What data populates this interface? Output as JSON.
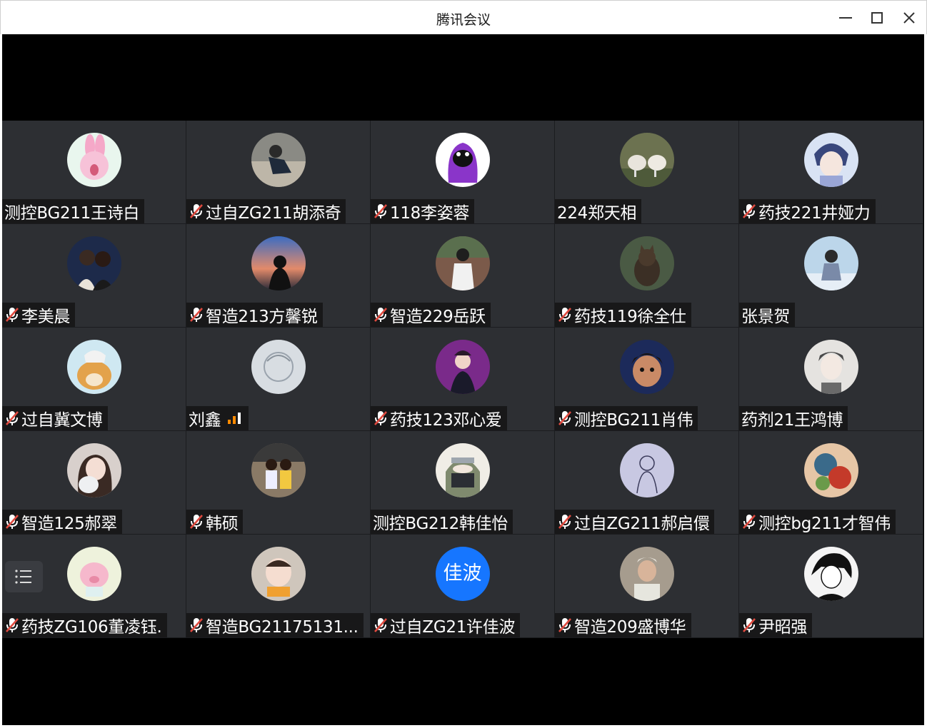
{
  "window": {
    "title": "腾讯会议"
  },
  "colors": {
    "stage": "#000000",
    "tile": "#2d2f33",
    "muted_icon": "#e04a3f",
    "signal": "#ff8a00",
    "avatar_blue": "#1676ff"
  },
  "participants": [
    {
      "name": "测控BG211王诗白",
      "muted": false,
      "avatar": "pink-rabbit-icon"
    },
    {
      "name": "过自ZG211胡添奇",
      "muted": true,
      "avatar": "photo-person-icon"
    },
    {
      "name": "118李姿蓉",
      "muted": true,
      "avatar": "purple-cartoon-icon"
    },
    {
      "name": "224郑天相",
      "muted": false,
      "avatar": "sheep-photo-icon"
    },
    {
      "name": "药技221井娅力",
      "muted": true,
      "avatar": "anime-boy-icon"
    },
    {
      "name": "李美晨",
      "muted": true,
      "avatar": "couple-photo-icon"
    },
    {
      "name": "智造213方馨锐",
      "muted": true,
      "avatar": "sunset-silhouette-icon"
    },
    {
      "name": "智造229岳跃",
      "muted": true,
      "avatar": "person-back-icon"
    },
    {
      "name": "药技119徐全仕",
      "muted": true,
      "avatar": "cat-photo-icon"
    },
    {
      "name": "张景贺",
      "muted": false,
      "avatar": "snow-person-icon"
    },
    {
      "name": "过自冀文博",
      "muted": true,
      "avatar": "shiba-dog-icon"
    },
    {
      "name": "刘鑫",
      "muted": false,
      "avatar": "sketch-icon",
      "signal": true
    },
    {
      "name": "药技123邓心爱",
      "muted": true,
      "avatar": "singer-photo-icon"
    },
    {
      "name": "测控BG211肖伟",
      "muted": true,
      "avatar": "cartoon-boy-icon"
    },
    {
      "name": "药剂21王鸿博",
      "muted": false,
      "avatar": "glasses-boy-icon"
    },
    {
      "name": "智造125郝翠",
      "muted": true,
      "avatar": "girl-cat-icon"
    },
    {
      "name": "韩硕",
      "muted": true,
      "avatar": "two-kids-icon"
    },
    {
      "name": "测控BG212韩佳怡",
      "muted": false,
      "avatar": "ninja-icon"
    },
    {
      "name": "过自ZG211郝启儇",
      "muted": true,
      "avatar": "line-drawing-icon"
    },
    {
      "name": "测控bg211才智伟",
      "muted": true,
      "avatar": "painting-icon"
    },
    {
      "name": "药技ZG106董凌钰.",
      "muted": true,
      "avatar": "pink-pig-icon"
    },
    {
      "name": "智造BG21175131...",
      "muted": true,
      "avatar": "baby-eating-icon"
    },
    {
      "name": "过自ZG21许佳波",
      "muted": true,
      "avatar": "text-avatar-icon",
      "avatar_text": "佳波"
    },
    {
      "name": "智造209盛博华",
      "muted": true,
      "avatar": "selfie-icon"
    },
    {
      "name": "尹昭强",
      "muted": true,
      "avatar": "manga-boy-icon"
    }
  ]
}
